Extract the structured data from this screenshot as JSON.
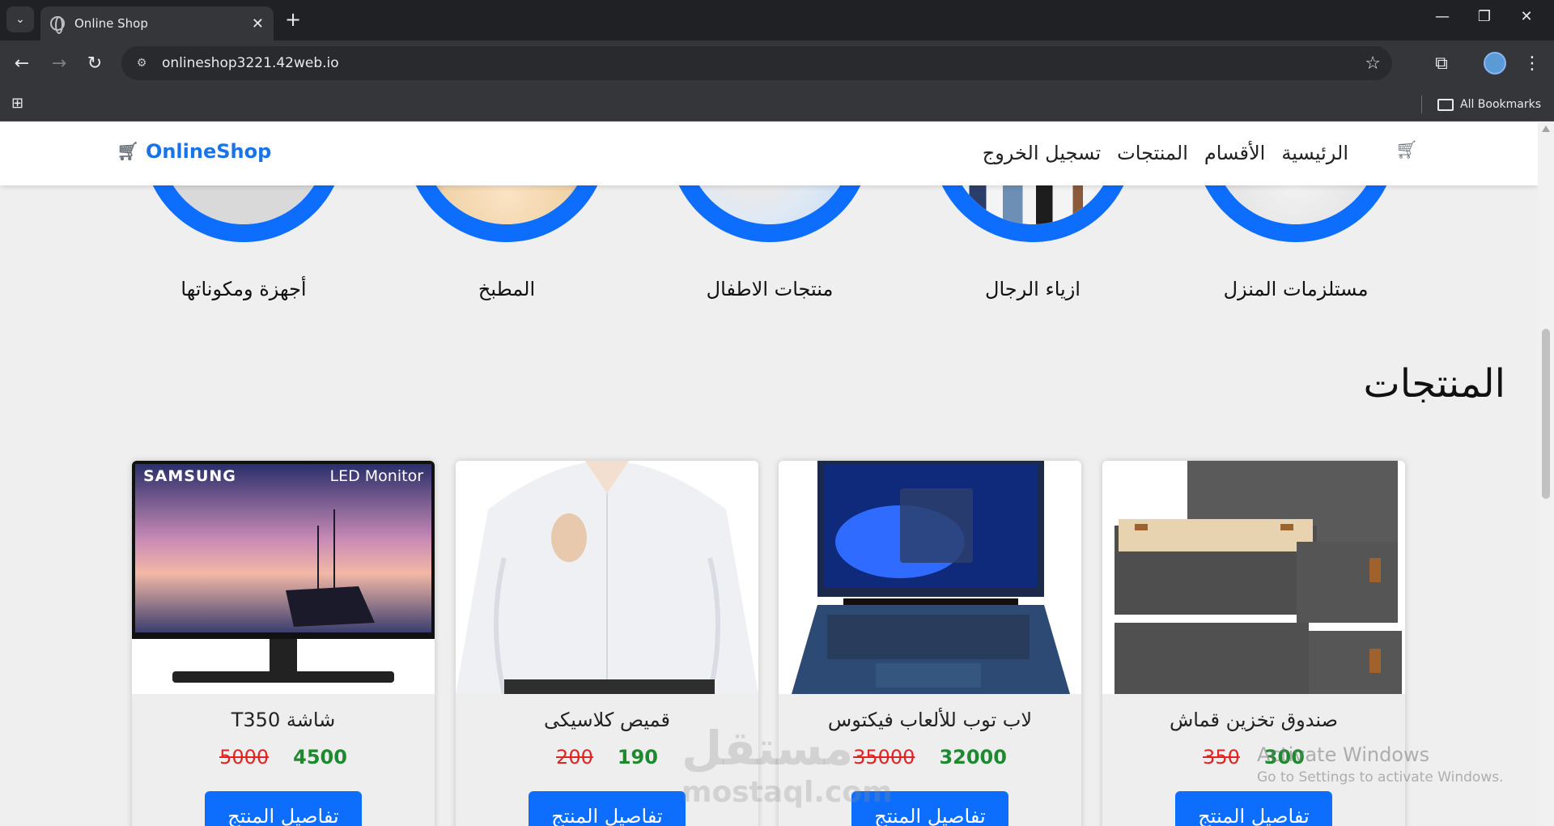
{
  "browser": {
    "tab_title": "Online Shop",
    "url": "onlineshop3221.42web.io",
    "bookmarks_label": "All Bookmarks"
  },
  "navbar": {
    "brand": "OnlineShop",
    "links": [
      "الرئيسية",
      "الأقسام",
      "المنتجات",
      "تسجيل الخروج"
    ]
  },
  "categories": [
    {
      "label": "مستلزمات المنزل",
      "icon": "home-supplies-image"
    },
    {
      "label": "ازياء الرجال",
      "icon": "men-fashion-image"
    },
    {
      "label": "منتجات الاطفال",
      "icon": "kids-products-image"
    },
    {
      "label": "المطبخ",
      "icon": "kitchen-image"
    },
    {
      "label": "أجهزة ومكوناتها",
      "icon": "devices-image"
    }
  ],
  "products_section": {
    "title": "المنتجات",
    "items": [
      {
        "name": "صندوق تخزين قماش",
        "price": "300",
        "old_price": "350",
        "button": "تفاصيل المنتج"
      },
      {
        "name": "لاب توب للألعاب فيكتوس",
        "price": "32000",
        "old_price": "35000",
        "button": "تفاصيل المنتج"
      },
      {
        "name": "قميص كلاسيكى",
        "price": "190",
        "old_price": "200",
        "button": "تفاصيل المنتج"
      },
      {
        "name": "شاشة T350",
        "price": "4500",
        "old_price": "5000",
        "button": "تفاصيل المنتج"
      }
    ],
    "monitor_brand": "SAMSUNG",
    "monitor_badge": "LED Monitor"
  },
  "overlays": {
    "activate_title": "Activate Windows",
    "activate_sub": "Go to Settings to activate Windows.",
    "mostaql_ar": "مستقل",
    "mostaql_en": "mostaql.com"
  },
  "colors": {
    "primary": "#0d6efd",
    "price_new": "#1e8a2f",
    "price_old": "#e02424"
  }
}
